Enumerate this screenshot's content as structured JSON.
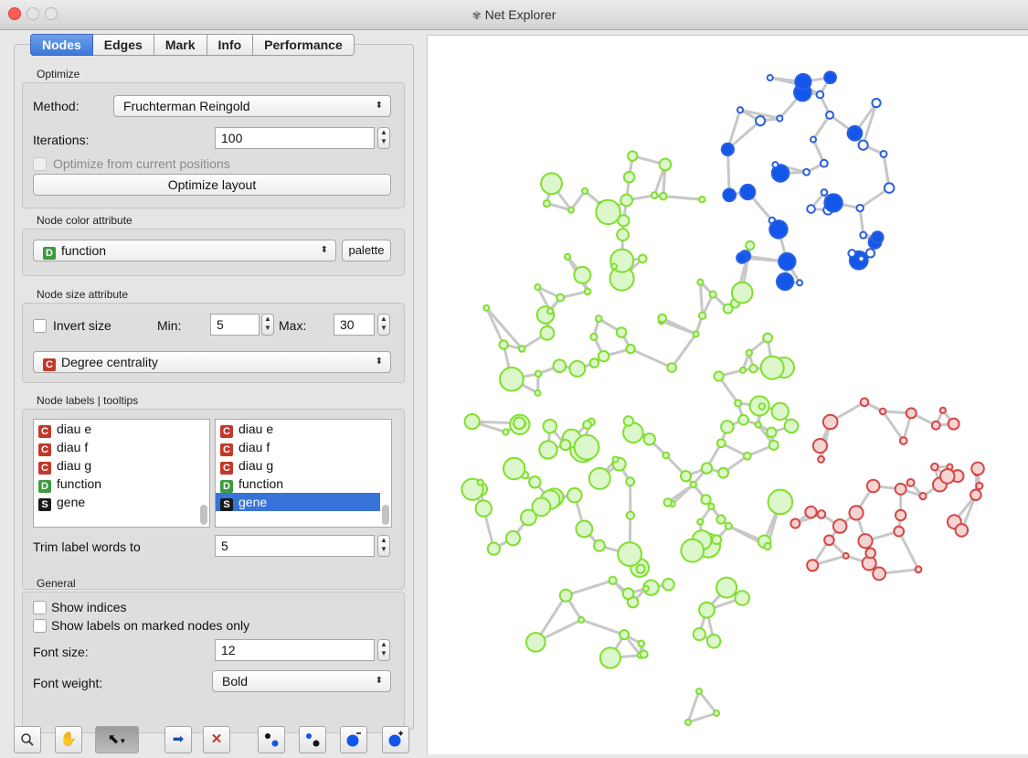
{
  "window": {
    "title": "Net Explorer",
    "icon": "network-app-icon"
  },
  "tabs": [
    "Nodes",
    "Edges",
    "Mark",
    "Info",
    "Performance"
  ],
  "optimize": {
    "section": "Optimize",
    "method_label": "Method:",
    "method_value": "Fruchterman Reingold",
    "iterations_label": "Iterations:",
    "iterations_value": "100",
    "from_current_label": "Optimize from current positions",
    "button": "Optimize layout"
  },
  "node_color": {
    "section": "Node color attribute",
    "badge": "D",
    "value": "function",
    "palette_button": "palette"
  },
  "node_size": {
    "section": "Node size attribute",
    "invert_label": "Invert size",
    "min_label": "Min:",
    "min_value": "5",
    "max_label": "Max:",
    "max_value": "30",
    "badge": "C",
    "value": "Degree centrality"
  },
  "node_labels": {
    "section": "Node labels | tooltips",
    "labels": [
      {
        "badge": "C",
        "text": "diau e"
      },
      {
        "badge": "C",
        "text": "diau f"
      },
      {
        "badge": "C",
        "text": "diau g"
      },
      {
        "badge": "D",
        "text": "function"
      },
      {
        "badge": "S",
        "text": "gene"
      }
    ],
    "tooltips": [
      {
        "badge": "C",
        "text": "diau e"
      },
      {
        "badge": "C",
        "text": "diau f"
      },
      {
        "badge": "C",
        "text": "diau g"
      },
      {
        "badge": "D",
        "text": "function"
      },
      {
        "badge": "S",
        "text": "gene",
        "selected": true
      }
    ],
    "trim_label": "Trim label words to",
    "trim_value": "5"
  },
  "general": {
    "section": "General",
    "show_indices": "Show indices",
    "show_marked_only": "Show labels on marked nodes only",
    "font_size_label": "Font size:",
    "font_size_value": "12",
    "font_weight_label": "Font weight:",
    "font_weight_value": "Bold"
  },
  "toolbar": [
    "zoom-icon",
    "pan-hand-icon",
    "select-arrow-icon",
    "send-marked-icon",
    "clear-selection-icon",
    "select-neighbors-icon",
    "select-all-icon",
    "shrink-nodes-icon",
    "enlarge-nodes-icon"
  ],
  "colors": {
    "green_fill": "#dcf7cc",
    "green_stroke": "#7fe02b",
    "blue_fill": "#1257ea",
    "blue_stroke": "#2a5fe0",
    "red_fill": "#f4d3d3",
    "red_stroke": "#d64545",
    "edge": "#c8c8c8"
  }
}
